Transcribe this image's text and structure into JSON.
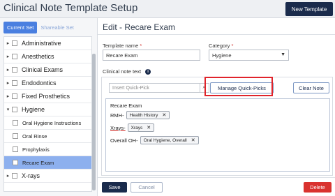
{
  "header": {
    "title": "Clinical Note Template Setup",
    "new_template_label": "New Template"
  },
  "sidebar": {
    "tabs": [
      {
        "label": "Current Set"
      },
      {
        "label": "Shareable Set"
      }
    ],
    "items": [
      {
        "label": "Administrative",
        "caret": "▸"
      },
      {
        "label": "Anesthetics",
        "caret": "▸"
      },
      {
        "label": "Clinical Exams",
        "caret": "▸"
      },
      {
        "label": "Endodontics",
        "caret": "▸"
      },
      {
        "label": "Fixed Prosthetics",
        "caret": "▸"
      },
      {
        "label": "Hygiene",
        "caret": "▾"
      },
      {
        "label": "Oral Hygiene Instructions"
      },
      {
        "label": "Oral Rinse"
      },
      {
        "label": "Prophylaxis"
      },
      {
        "label": "Recare Exam"
      },
      {
        "label": "X-rays",
        "caret": "▸"
      }
    ],
    "selected_item": "Recare Exam"
  },
  "edit": {
    "title": "Edit - Recare Exam",
    "template_name_label": "Template name",
    "template_name_value": "Recare Exam",
    "category_label": "Category",
    "category_value": "Hygiene",
    "required_mark": "*",
    "note_text_label": "Clinical note text",
    "info_icon": "i",
    "quick_pick_placeholder": "Insert Quick-Pick",
    "manage_quick_picks_label": "Manage Quick-Picks",
    "clear_note_label": "Clear Note",
    "note": {
      "heading": "Recare Exam",
      "lines": [
        {
          "label": "RMH-",
          "chip": "Health History"
        },
        {
          "label": "Xrays-",
          "chip": "Xrays"
        },
        {
          "label": "Overall OH-",
          "chip": "Oral Hygiene, Overall"
        }
      ]
    }
  },
  "footer": {
    "save_label": "Save",
    "cancel_label": "Cancel",
    "delete_label": "Delete"
  },
  "colors": {
    "primary": "#1a2b4c",
    "accent": "#4a7fe0",
    "selected_row": "#8db0ee",
    "danger": "#d9322e",
    "highlight": "#e0242b"
  }
}
